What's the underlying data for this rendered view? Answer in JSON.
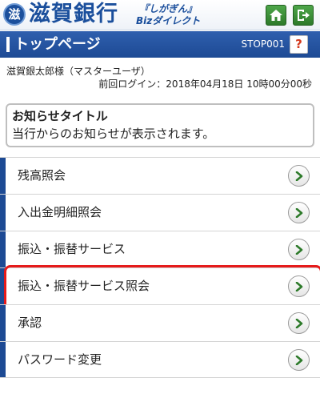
{
  "header": {
    "logo_char": "滋",
    "bank_name": "滋賀銀行",
    "service_top": "『しがぎん』",
    "service_bottom": "Bizダイレクト",
    "home_icon": "home-icon",
    "logout_icon": "logout-icon",
    "accent_color": "#1b4f9c",
    "button_color": "#2d7a2a"
  },
  "titlebar": {
    "title": "トップページ",
    "screen_id": "STOP001",
    "help_label": "?",
    "bar_color": "#1d4a94"
  },
  "user": {
    "name": "滋賀銀太郎様（マスターユーザ）",
    "last_login": "前回ログイン：2018年04月18日 10時00分00秒"
  },
  "notice": {
    "title": "お知らせタイトル",
    "body": "当行からのお知らせが表示されます。"
  },
  "menu": {
    "items": [
      {
        "label": "残高照会"
      },
      {
        "label": "入出金明細照会"
      },
      {
        "label": "振込・振替サービス"
      },
      {
        "label": "振込・振替サービス照会"
      },
      {
        "label": "承認"
      },
      {
        "label": "パスワード変更"
      }
    ],
    "highlighted_index": 3,
    "highlight_color": "#e61a1a",
    "chevron_color": "#2d7a2a"
  }
}
